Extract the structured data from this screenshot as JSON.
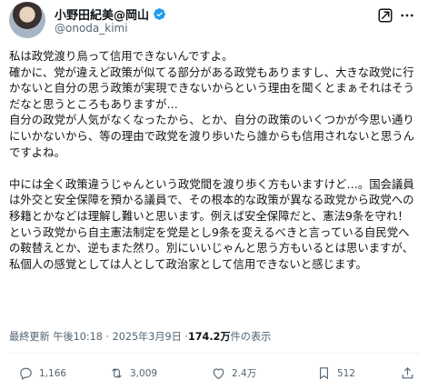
{
  "author": {
    "name": "小野田紀美@岡山",
    "handle": "@onoda_kimi"
  },
  "post": {
    "paragraphs": [
      [
        "私は政党渡り鳥って信用できないんですよ。",
        "確かに、党が違えど政策が似てる部分がある政党もありますし、大きな政党に行かないと自分の思う政策が実現できないからという理由を聞くとまぁそれはそうだなと思うところもありますが…",
        "自分の政党が人気がなくなったから、とか、自分の政策のいくつかが今思い通りにいかないから、等の理由で政党を渡り歩いたら誰からも信用されないと思うんですよね。"
      ],
      [
        "中には全く政策違うじゃんという政党間を渡り歩く方もいますけど…。国会議員は外交と安全保障を預かる議員で、その根本的な政策が異なる政党から政党への移籍とかなどは理解し難いと思います。例えば安全保障だと、憲法9条を守れ！という政党から自主憲法制定を党是とし9条を変えるべきと言っている自民党への鞍替えとか、逆もまた然り。別にいいじゃんと思う方もいるとは思いますが、私個人の感覚としては人として政治家として信用できないと感じます。"
      ]
    ]
  },
  "meta": {
    "last_updated": "最終更新 午後10:18 · 2025年3月9日 · ",
    "views_count": "174.2万",
    "views_label": " 件の表示"
  },
  "actions": {
    "replies": "1,166",
    "reposts": "3,009",
    "likes": "2.4万",
    "bookmarks": "512"
  },
  "colors": {
    "verified": "#1d9bf0",
    "text": "#0f1419",
    "secondary": "#536471"
  }
}
